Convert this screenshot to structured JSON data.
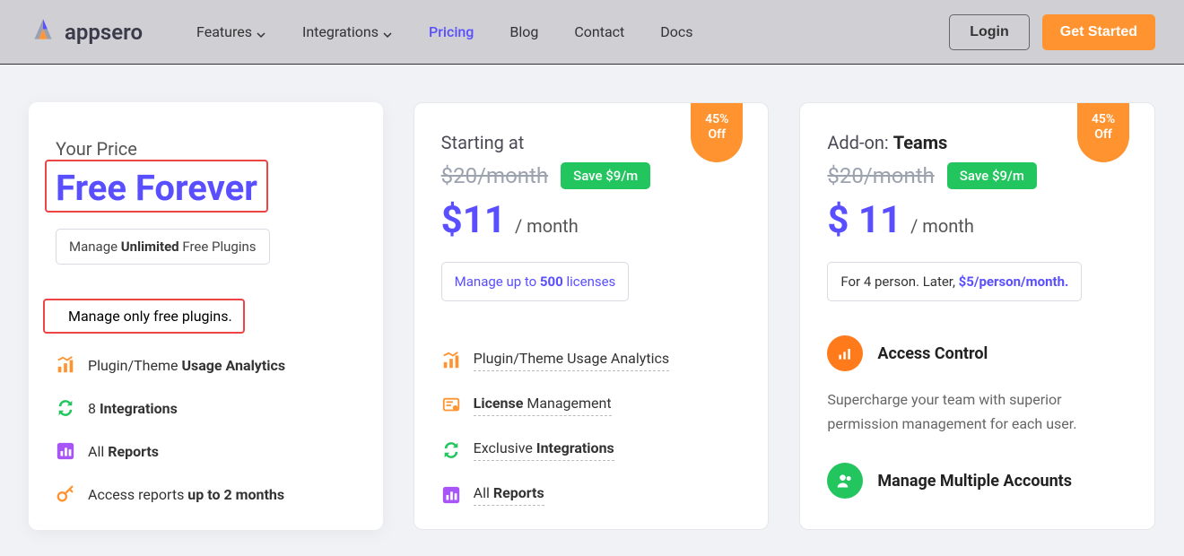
{
  "header": {
    "brand": "appsero",
    "nav": {
      "features": "Features",
      "integrations": "Integrations",
      "pricing": "Pricing",
      "blog": "Blog",
      "contact": "Contact",
      "docs": "Docs"
    },
    "login": "Login",
    "get_started": "Get Started"
  },
  "free": {
    "your_price": "Your Price",
    "title": "Free Forever",
    "pill_pre": "Manage ",
    "pill_bold": "Unlimited",
    "pill_post": " Free Plugins",
    "feat0_pre": "Manage only ",
    "feat0_bold": "free plugins.",
    "feat1_pre": "Plugin/Theme ",
    "feat1_bold": "Usage Analytics",
    "feat2_pre": "8 ",
    "feat2_bold": "Integrations",
    "feat3_pre": "All ",
    "feat3_bold": "Reports",
    "feat4_pre": "Access reports ",
    "feat4_bold": "up to 2 months"
  },
  "mid": {
    "starting": "Starting at",
    "discount_pct": "45%",
    "discount_off": "Off",
    "strike": "$20/month",
    "save": "Save $9/m",
    "price": "$11",
    "unit": "/ month",
    "license_pre": "Manage up to ",
    "license_bold": "500",
    "license_post": " licenses",
    "feat1": "Plugin/Theme Usage Analytics",
    "feat2_pre": "License",
    "feat2_post": " Management",
    "feat3_pre": "Exclusive ",
    "feat3_bold": "Integrations",
    "feat4_pre": "All ",
    "feat4_bold": "Reports"
  },
  "teams": {
    "addon_pre": "Add-on: ",
    "addon_bold": "Teams",
    "discount_pct": "45%",
    "discount_off": "Off",
    "strike": "$20/month",
    "save": "Save $9/m",
    "price": "$ 11",
    "unit": "/ month",
    "box_pre": "For 4 person. Later, ",
    "box_accent": "$5/person/month.",
    "access_title": "Access Control",
    "access_desc": "Supercharge your team with superior permission management for each user.",
    "mma_title": "Manage Multiple Accounts"
  }
}
